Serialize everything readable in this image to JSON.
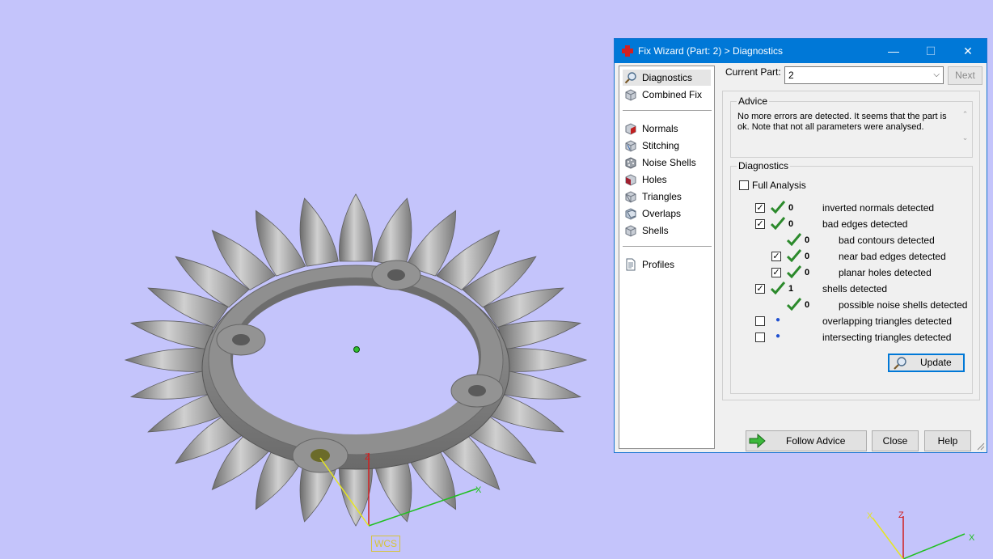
{
  "viewport": {
    "wcs_label": "WCS",
    "axis_labels": {
      "z": "Z",
      "x": "X"
    },
    "background_color": "#c4c4fb"
  },
  "dialog": {
    "title": "Fix Wizard (Part: 2) > Diagnostics",
    "window_controls": {
      "minimize": "—",
      "maximize": "☐",
      "close": "✕"
    },
    "nav": {
      "top_items": [
        {
          "label": "Diagnostics",
          "icon": "magnifier-icon",
          "selected": true
        },
        {
          "label": "Combined Fix",
          "icon": "cube-icon"
        }
      ],
      "fix_items": [
        {
          "label": "Normals",
          "icon": "normals-cube-icon"
        },
        {
          "label": "Stitching",
          "icon": "stitching-cube-icon"
        },
        {
          "label": "Noise Shells",
          "icon": "noise-shells-icon"
        },
        {
          "label": "Holes",
          "icon": "holes-cube-icon"
        },
        {
          "label": "Triangles",
          "icon": "triangles-cube-icon"
        },
        {
          "label": "Overlaps",
          "icon": "overlaps-cube-icon"
        },
        {
          "label": "Shells",
          "icon": "shells-cube-icon"
        }
      ],
      "bottom_items": [
        {
          "label": "Profiles",
          "icon": "document-icon"
        }
      ]
    },
    "current_part_label": "Current Part:",
    "current_part_value": "2",
    "next_label": "Next",
    "advice": {
      "title": "Advice",
      "text": "No more errors are detected. It seems that the part is ok. Note that not all parameters were analysed."
    },
    "diagnostics": {
      "title": "Diagnostics",
      "full_analysis_label": "Full Analysis",
      "full_analysis_checked": false,
      "rows": [
        {
          "checkbox": true,
          "checked": true,
          "status": "ok",
          "count": "0",
          "text": "inverted normals detected",
          "indent": 0
        },
        {
          "checkbox": true,
          "checked": true,
          "status": "ok",
          "count": "0",
          "text": "bad edges detected",
          "indent": 0
        },
        {
          "checkbox": false,
          "checked": false,
          "status": "ok",
          "count": "0",
          "text": "bad contours detected",
          "indent": 1
        },
        {
          "checkbox": true,
          "checked": true,
          "status": "ok",
          "count": "0",
          "text": "near bad edges detected",
          "indent": 1
        },
        {
          "checkbox": true,
          "checked": true,
          "status": "ok",
          "count": "0",
          "text": "planar holes detected",
          "indent": 1
        },
        {
          "checkbox": true,
          "checked": true,
          "status": "ok",
          "count": "1",
          "text": "shells detected",
          "indent": 0
        },
        {
          "checkbox": false,
          "checked": false,
          "status": "ok",
          "count": "0",
          "text": "possible noise shells detected",
          "indent": 1
        },
        {
          "checkbox": true,
          "checked": false,
          "status": "pending",
          "count": "",
          "text": "overlapping triangles detected",
          "indent": 0
        },
        {
          "checkbox": true,
          "checked": false,
          "status": "pending",
          "count": "",
          "text": "intersecting triangles detected",
          "indent": 0
        }
      ],
      "update_label": "Update"
    },
    "buttons": {
      "follow_advice": "Follow Advice",
      "close": "Close",
      "help": "Help"
    },
    "colors": {
      "titlebar": "#0078d7",
      "ok_check": "#2c8a2c",
      "accent_button_border": "#0078d7"
    }
  }
}
